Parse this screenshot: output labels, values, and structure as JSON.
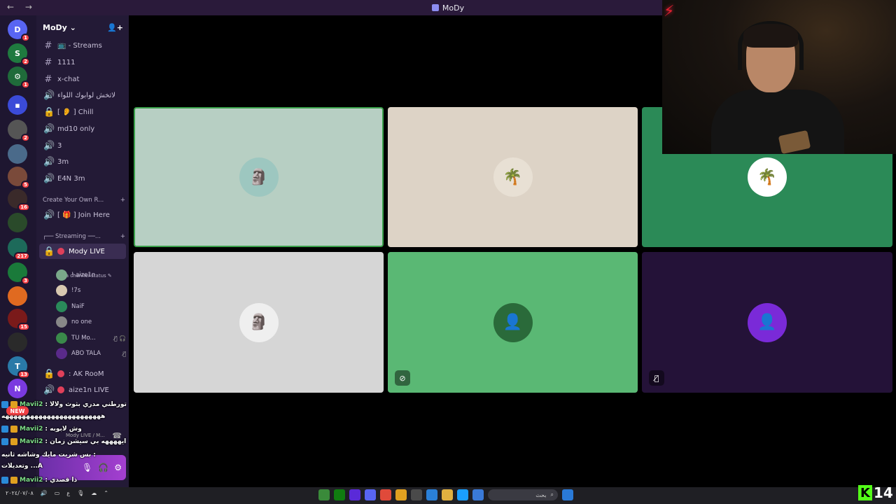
{
  "window": {
    "title": "MoDy",
    "nav": "← →"
  },
  "servers": [
    {
      "label": "D",
      "badge": "1",
      "color": "#5865f2"
    },
    {
      "label": "S",
      "badge": "2",
      "color": "#1f7a3f"
    },
    {
      "label": "⚙",
      "badge": "1",
      "color": "#1f6b3a"
    },
    {
      "label": "▪",
      "badge": "",
      "color": "#3b4bd8"
    },
    {
      "label": "",
      "badge": "2",
      "color": "#555"
    },
    {
      "label": "",
      "badge": "",
      "color": "#4a6a8a"
    },
    {
      "label": "",
      "badge": "5",
      "color": "#7a4a3a"
    },
    {
      "label": "",
      "badge": "16",
      "color": "#3a2a2a"
    },
    {
      "label": "",
      "badge": "",
      "color": "#2a4a2a"
    },
    {
      "label": "",
      "badge": "217",
      "color": "#1d6a5a"
    },
    {
      "label": "",
      "badge": "3",
      "color": "#1a7a3a"
    },
    {
      "label": "",
      "badge": "",
      "color": "#e06a20"
    },
    {
      "label": "",
      "badge": "15",
      "color": "#7a1a1a"
    },
    {
      "label": "",
      "badge": "",
      "color": "#2a2a2a"
    },
    {
      "label": "T",
      "badge": "13",
      "color": "#2a7aa8"
    },
    {
      "label": "N",
      "badge": "",
      "color": "#7a3ae0"
    }
  ],
  "new_pill": "NEW",
  "guild": {
    "name": "MoDy"
  },
  "channels": [
    {
      "glyph": "#",
      "name": "📺 - Streams"
    },
    {
      "glyph": "#",
      "name": "1111"
    },
    {
      "glyph": "#",
      "name": "x-chat"
    },
    {
      "glyph": "🔊",
      "name": "لاتخش لوابوك اللواء"
    },
    {
      "glyph": "🔒",
      "name": "[ 👂 ] Chill"
    },
    {
      "glyph": "🔊",
      "name": "md10 only"
    },
    {
      "glyph": "🔊",
      "name": "3"
    },
    {
      "glyph": "🔊",
      "name": "3m"
    },
    {
      "glyph": "🔊",
      "name": "E4N 3m"
    }
  ],
  "category_create": "Create Your Own R...",
  "join_here": "[ 🎁 ] Join Here",
  "category_streaming": "┌── Streaming ──...",
  "live_channel": {
    "name": "Mody LIVE",
    "status": "Set a channel status"
  },
  "voice_users": [
    {
      "name": "! aize1n",
      "color": "#7aa88a",
      "mute": ""
    },
    {
      "name": "!7s",
      "color": "#d8c8b0",
      "mute": ""
    },
    {
      "name": "NaiF",
      "color": "#2a8a5a",
      "mute": ""
    },
    {
      "name": "no one",
      "color": "#888",
      "mute": ""
    },
    {
      "name": "TU Mo...",
      "color": "#3a8a4a",
      "mute": "🎙̸ 🎧"
    },
    {
      "name": "ABO TALA",
      "color": "#5a2a8a",
      "mute": "🎙̸"
    }
  ],
  "other_channels": [
    {
      "glyph": "🔒",
      "name": ": AK RooM"
    },
    {
      "glyph": "🔊",
      "name": "aize1n LIVE"
    }
  ],
  "voice_connected": "Mody LIVE / M...",
  "chat_lines": [
    {
      "name": "Mavii2",
      "text": ": لا تورطني مدري بثوث ولالا"
    },
    {
      "name": "",
      "text": "ههههههههههههههههههههههههه"
    },
    {
      "name": "Mavii2",
      "text": ": وش لابوبه"
    },
    {
      "name": "Mavii2",
      "text": ": اي ايههههه بي سيشن زمان"
    },
    {
      "name": "",
      "text": "بس شريت مايك وشاشه ثانيه :"
    },
    {
      "name": "",
      "text": "وتعديلات ...A"
    },
    {
      "name": "Mavii2",
      "text": ": ذا قصدي"
    }
  ],
  "tiles": [
    {
      "bg": "#b7cfc3",
      "border": "#3aa04a",
      "avatar_bg": "#9dc7c0",
      "glyph": "🗿",
      "corner": ""
    },
    {
      "bg": "#ddd3c6",
      "border": "",
      "avatar_bg": "#e8e0d4",
      "glyph": "🌴",
      "corner": ""
    },
    {
      "bg": "#2b8a57",
      "border": "",
      "avatar_bg": "#ffffff",
      "glyph": "🌴",
      "corner": ""
    },
    {
      "bg": "#d6d6d6",
      "border": "",
      "avatar_bg": "#efefef",
      "glyph": "🗿",
      "corner": ""
    },
    {
      "bg": "#5ab874",
      "border": "",
      "avatar_bg": "#2a6a3a",
      "glyph": "👤",
      "corner": "⊘"
    },
    {
      "bg": "#241238",
      "border": "",
      "avatar_bg": "#7a2ad8",
      "glyph": "👤",
      "corner": "🎙̸"
    }
  ],
  "taskbar": {
    "date": "٢٠٢٤/٠٧/٠٨",
    "lang": "ع",
    "search_placeholder": "بحث",
    "apps": [
      "#3a8a3a",
      "#107c10",
      "#5a2ad8",
      "#5865f2",
      "#e04a3a",
      "#e0a020",
      "#4a4a4a",
      "#2a80d8",
      "#e0b040",
      "#1a9fff",
      "#3a7ad8",
      "#666"
    ]
  },
  "overlay": {
    "kick_count": "14",
    "kick_letter": "K"
  }
}
